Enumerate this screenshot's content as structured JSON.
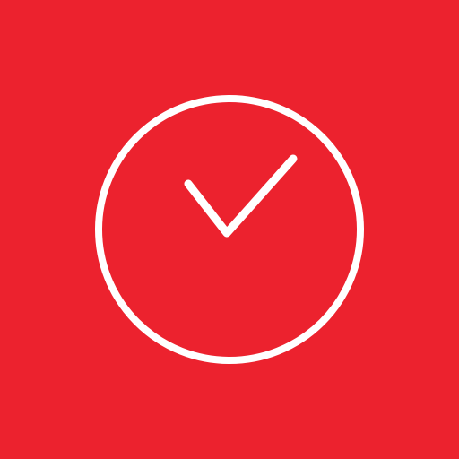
{
  "app_icon": {
    "background_color": "#EC222E",
    "foreground_color": "#FFFFFF",
    "icon": "clock-check-icon",
    "parts": [
      "clock-face-circle",
      "checkmark-clock-hands"
    ]
  }
}
